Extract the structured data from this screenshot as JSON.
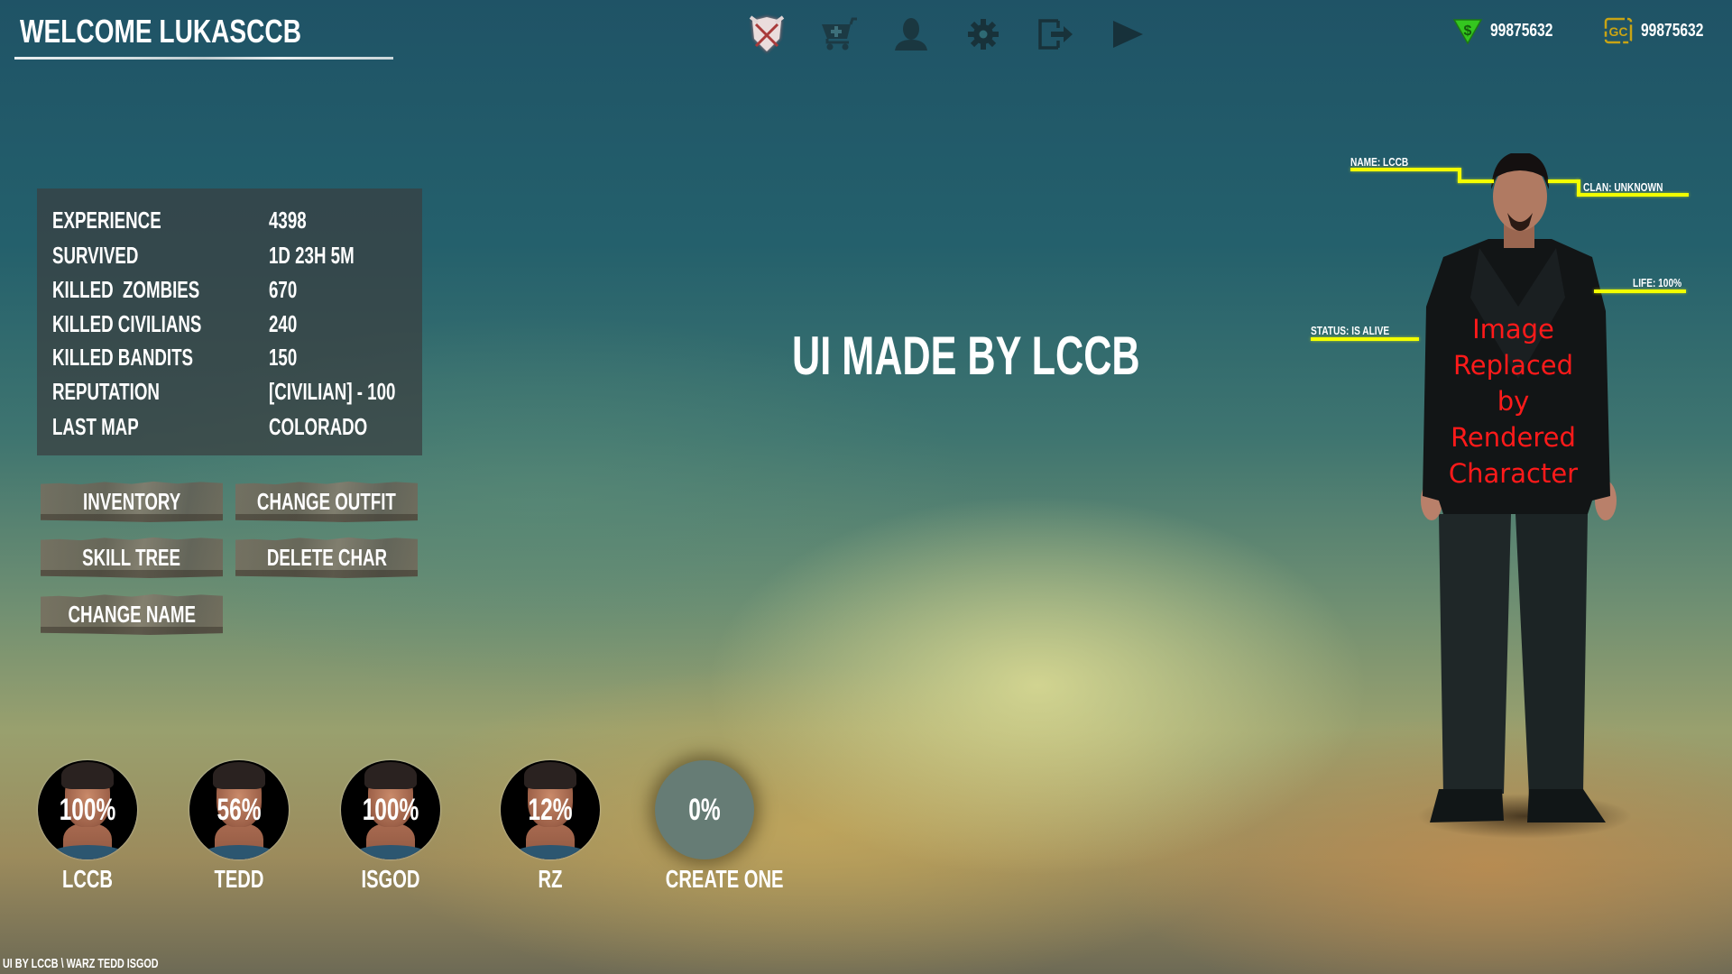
{
  "header": {
    "welcome": "WELCOME LUKASCCB"
  },
  "nav": [
    {
      "icon": "crossed-swords-shield-icon",
      "label": "Play",
      "active": true
    },
    {
      "icon": "shopping-cart-icon",
      "label": "Store"
    },
    {
      "icon": "user-icon",
      "label": "Profile"
    },
    {
      "icon": "gear-icon",
      "label": "Settings"
    },
    {
      "icon": "exit-icon",
      "label": "Exit"
    },
    {
      "icon": "play-icon",
      "label": "Play Game"
    }
  ],
  "currency": {
    "dollars": {
      "icon": "green-dollar-icon",
      "value": "99875632",
      "color": "#3fd12a"
    },
    "gc": {
      "icon": "gc-coin-icon",
      "value": "99875632",
      "color": "#d9b21a"
    }
  },
  "stats": [
    {
      "label": "EXPERIENCE",
      "value": "4398"
    },
    {
      "label": "SURVIVED",
      "value": "1D 23H 5M"
    },
    {
      "label": "KILLED  ZOMBIES",
      "value": "670"
    },
    {
      "label": "KILLED CIVILIANS",
      "value": "240"
    },
    {
      "label": "KILLED BANDITS",
      "value": "150"
    },
    {
      "label": "REPUTATION",
      "value": "[CIVILIAN] - 100"
    },
    {
      "label": "LAST MAP",
      "value": "COLORADO"
    }
  ],
  "actions": {
    "inventory": "INVENTORY",
    "change_outfit": "CHANGE OUTFIT",
    "skill_tree": "SKILL TREE",
    "delete_char": "DELETE CHAR",
    "change_name": "CHANGE NAME"
  },
  "center_credit": "UI MADE BY LCCB",
  "characters": [
    {
      "name": "LCCB",
      "percent": "100%"
    },
    {
      "name": "TEDD",
      "percent": "56%"
    },
    {
      "name": "ISGOD",
      "percent": "100%"
    },
    {
      "name": "RZ",
      "percent": "12%"
    },
    {
      "name": "CREATE ONE",
      "percent": "0%",
      "empty": true
    }
  ],
  "character_info": {
    "name": "NAME: LCCB",
    "clan": "CLAN: UNKNOWN",
    "life": "LIFE: 100%",
    "status": "STATUS: IS ALIVE",
    "line_color": "#f2ff00"
  },
  "render_placeholder": "Image Replaced by Rendered Character",
  "footer": "UI BY LCCB \\ WARZ TEDD ISGOD"
}
